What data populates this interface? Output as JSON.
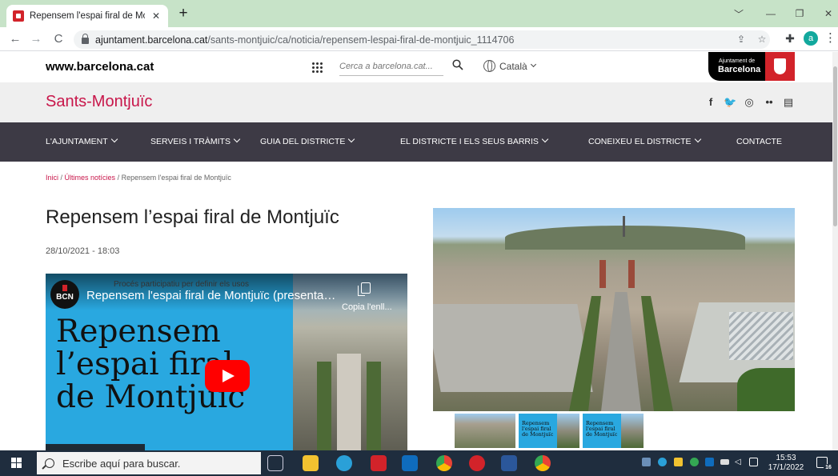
{
  "browser": {
    "tab_title": "Repensem l'espai firal de Montjuï",
    "tab_close": "✕",
    "new_tab": "+",
    "url_host": "ajuntament.barcelona.cat",
    "url_path": "/sants-montjuic/ca/noticia/repensem-lespai-firal-de-montjuic_1114706",
    "profile_initial": "a"
  },
  "site": {
    "domain": "www.barcelona.cat",
    "search_placeholder": "Cerca a barcelona.cat...",
    "language": "Català",
    "logo_line1": "Ajuntament de",
    "logo_line2": "Barcelona",
    "district": "Sants-Montjuïc",
    "social": [
      "f",
      "🐦",
      "◎",
      "••",
      "▤"
    ]
  },
  "nav": {
    "items": [
      {
        "label": "L'AJUNTAMENT",
        "dropdown": true
      },
      {
        "label": "SERVEIS I TRÀMITS",
        "dropdown": true
      },
      {
        "label": "GUIA DEL DISTRICTE",
        "dropdown": true
      },
      {
        "label": "EL DISTRICTE I ELS SEUS BARRIS",
        "dropdown": true
      },
      {
        "label": "CONEIXEU EL DISTRICTE",
        "dropdown": true
      },
      {
        "label": "CONTACTE",
        "dropdown": false
      }
    ]
  },
  "breadcrumb": {
    "home": "Inici",
    "section": "Últimes notícies",
    "current": "Repensem l'espai firal de Montjuïc",
    "separator": " / "
  },
  "article": {
    "title": "Repensem l’espai firal de Montjuïc",
    "date": "28/10/2021 - 18:03"
  },
  "video": {
    "channel_badge": "BCN",
    "subtitle": "Procés participatiu per definir els usos",
    "title": "Repensem l'espai firal de Montjuïc (presentac...",
    "copy_label": "Copia l'enll...",
    "poster_text": [
      "Repensem",
      "l’espai firal",
      "de Montjuïc"
    ]
  },
  "gallery": {
    "thumb_poster_text": "Repensem l'espai firal de Montjuïc"
  },
  "taskbar": {
    "search_placeholder": "Escribe aquí para buscar.",
    "time": "15:53",
    "date": "17/1/2022",
    "notification_count": "16"
  },
  "colors": {
    "accent": "#c8164a",
    "nav_bg": "#3d3a45",
    "tabstrip": "#c7e3c8",
    "video_blue": "#29a8e0"
  }
}
